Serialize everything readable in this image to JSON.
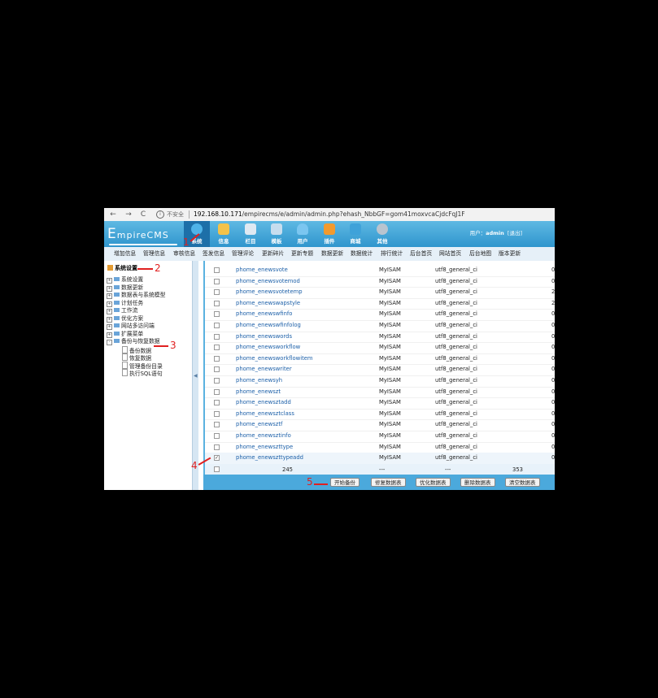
{
  "browser": {
    "back": "←",
    "forward": "→",
    "reload": "C",
    "insecure_label": "不安全",
    "url_host": "192.168.10.171",
    "url_path": "/empirecms/e/admin/admin.php?ehash_NbbGF=gom41moxvcaCjdcFqJ1F"
  },
  "header": {
    "logo": "mpireCMS",
    "logo_initial": "E",
    "modules": [
      {
        "label": "系统",
        "color": "#4fb3e8"
      },
      {
        "label": "信息",
        "color": "#f3c24a"
      },
      {
        "label": "栏目",
        "color": "#dfe9f2"
      },
      {
        "label": "模板",
        "color": "#c7ddee"
      },
      {
        "label": "用户",
        "color": "#7bc6f0"
      },
      {
        "label": "插件",
        "color": "#f29a2e"
      },
      {
        "label": "商城",
        "color": "#3fa2d9"
      },
      {
        "label": "其他",
        "color": "#b9c4cf"
      }
    ],
    "user_prefix": "用户：",
    "username": "admin",
    "logout": "[退出]"
  },
  "submenu": [
    "增加信息",
    "管理信息",
    "审核信息",
    "签发信息",
    "管理评论",
    "更新碎片",
    "更新专题",
    "数据更新",
    "数据统计",
    "排行统计",
    "后台首页",
    "网站首页",
    "后台地图",
    "版本更新"
  ],
  "tree": {
    "title": "系统设置",
    "items": [
      {
        "label": "系统设置",
        "sign": "+"
      },
      {
        "label": "数据更新",
        "sign": "+"
      },
      {
        "label": "数据表与系统模型",
        "sign": "+"
      },
      {
        "label": "计划任务",
        "sign": "+"
      },
      {
        "label": "工作流",
        "sign": "+"
      },
      {
        "label": "优化方案",
        "sign": "+"
      },
      {
        "label": "网站多访问端",
        "sign": "+"
      },
      {
        "label": "扩展菜单",
        "sign": "+"
      },
      {
        "label": "备份与恢复数据",
        "sign": "-"
      }
    ],
    "children": [
      "备份数据",
      "恢复数据",
      "管理备份目录",
      "执行SQL语句"
    ]
  },
  "table": {
    "rows": [
      {
        "name": "phome_enewsvote",
        "engine": "MyISAM",
        "collation": "utf8_general_ci",
        "count": "0"
      },
      {
        "name": "phome_enewsvotemod",
        "engine": "MyISAM",
        "collation": "utf8_general_ci",
        "count": "0"
      },
      {
        "name": "phome_enewsvotetemp",
        "engine": "MyISAM",
        "collation": "utf8_general_ci",
        "count": "2"
      },
      {
        "name": "phome_enewswapstyle",
        "engine": "MyISAM",
        "collation": "utf8_general_ci",
        "count": "2"
      },
      {
        "name": "phome_enewswfinfo",
        "engine": "MyISAM",
        "collation": "utf8_general_ci",
        "count": "0"
      },
      {
        "name": "phome_enewswfinfolog",
        "engine": "MyISAM",
        "collation": "utf8_general_ci",
        "count": "0"
      },
      {
        "name": "phome_enewswords",
        "engine": "MyISAM",
        "collation": "utf8_general_ci",
        "count": "0"
      },
      {
        "name": "phome_enewsworkflow",
        "engine": "MyISAM",
        "collation": "utf8_general_ci",
        "count": "0"
      },
      {
        "name": "phome_enewsworkflowitem",
        "engine": "MyISAM",
        "collation": "utf8_general_ci",
        "count": "0"
      },
      {
        "name": "phome_enewswriter",
        "engine": "MyISAM",
        "collation": "utf8_general_ci",
        "count": "0"
      },
      {
        "name": "phome_enewsyh",
        "engine": "MyISAM",
        "collation": "utf8_general_ci",
        "count": "0"
      },
      {
        "name": "phome_enewszt",
        "engine": "MyISAM",
        "collation": "utf8_general_ci",
        "count": "0"
      },
      {
        "name": "phome_enewsztadd",
        "engine": "MyISAM",
        "collation": "utf8_general_ci",
        "count": "0"
      },
      {
        "name": "phome_enewsztclass",
        "engine": "MyISAM",
        "collation": "utf8_general_ci",
        "count": "0"
      },
      {
        "name": "phome_enewsztf",
        "engine": "MyISAM",
        "collation": "utf8_general_ci",
        "count": "0"
      },
      {
        "name": "phome_enewsztinfo",
        "engine": "MyISAM",
        "collation": "utf8_general_ci",
        "count": "0"
      },
      {
        "name": "phome_enewszttype",
        "engine": "MyISAM",
        "collation": "utf8_general_ci",
        "count": "0"
      },
      {
        "name": "phome_enewszttypeadd",
        "engine": "MyISAM",
        "collation": "utf8_general_ci",
        "count": "0",
        "checked": true
      }
    ],
    "summary": {
      "tables": "245",
      "engine": "---",
      "collation": "---",
      "count": "353"
    }
  },
  "buttons": {
    "start_backup": "开始备份",
    "repair": "修复数据表",
    "optimize": "优化数据表",
    "delete": "删除数据表",
    "empty": "清空数据表"
  },
  "annotations": [
    "1",
    "2",
    "3",
    "4",
    "5"
  ],
  "colors": {
    "header": "#2f95cd",
    "annotation": "#e02020",
    "link": "#1b5fa8"
  }
}
